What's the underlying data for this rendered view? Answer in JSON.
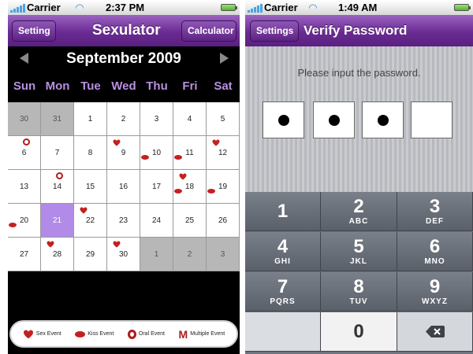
{
  "left": {
    "statusbar": {
      "carrier": "Carrier",
      "time": "2:37 PM"
    },
    "nav": {
      "left_button": "Setting",
      "title": "Sexulator",
      "right_button": "Calculator"
    },
    "calendar": {
      "month": "September 2009",
      "weekdays": [
        "Sun",
        "Mon",
        "Tue",
        "Wed",
        "Thu",
        "Fri",
        "Sat"
      ],
      "weeks": [
        [
          {
            "d": "30",
            "t": "other"
          },
          {
            "d": "31",
            "t": "other"
          },
          {
            "d": "1"
          },
          {
            "d": "2"
          },
          {
            "d": "3"
          },
          {
            "d": "4"
          },
          {
            "d": "5"
          }
        ],
        [
          {
            "d": "6",
            "m": [
              "oral"
            ]
          },
          {
            "d": "7"
          },
          {
            "d": "8"
          },
          {
            "d": "9",
            "m": [
              "heart"
            ]
          },
          {
            "d": "10",
            "m": [
              "kiss"
            ]
          },
          {
            "d": "11",
            "m": [
              "kiss"
            ]
          },
          {
            "d": "12",
            "m": [
              "heart"
            ]
          }
        ],
        [
          {
            "d": "13"
          },
          {
            "d": "14",
            "m": [
              "oral"
            ]
          },
          {
            "d": "15"
          },
          {
            "d": "16"
          },
          {
            "d": "17"
          },
          {
            "d": "18",
            "m": [
              "heart",
              "kiss"
            ]
          },
          {
            "d": "19",
            "m": [
              "kiss"
            ]
          }
        ],
        [
          {
            "d": "20",
            "m": [
              "kiss"
            ]
          },
          {
            "d": "21",
            "t": "selected"
          },
          {
            "d": "22",
            "m": [
              "heart"
            ]
          },
          {
            "d": "23"
          },
          {
            "d": "24"
          },
          {
            "d": "25"
          },
          {
            "d": "26"
          }
        ],
        [
          {
            "d": "27"
          },
          {
            "d": "28",
            "m": [
              "heart"
            ]
          },
          {
            "d": "29"
          },
          {
            "d": "30",
            "m": [
              "heart"
            ]
          },
          {
            "d": "1",
            "t": "other"
          },
          {
            "d": "2",
            "t": "other"
          },
          {
            "d": "3",
            "t": "other"
          }
        ]
      ]
    },
    "legend": {
      "sex": "Sex Event",
      "kiss": "Kiss Event",
      "oral": "Oral Event",
      "multiple_symbol": "M",
      "multiple": "Multiple Event"
    }
  },
  "right": {
    "statusbar": {
      "carrier": "Carrier",
      "time": "1:49 AM"
    },
    "nav": {
      "back_button": "Settings",
      "title": "Verify Password"
    },
    "prompt": "Please input the password.",
    "password_filled": [
      true,
      true,
      true,
      false
    ],
    "keys": [
      {
        "n": "1",
        "l": ""
      },
      {
        "n": "2",
        "l": "ABC"
      },
      {
        "n": "3",
        "l": "DEF"
      },
      {
        "n": "4",
        "l": "GHI"
      },
      {
        "n": "5",
        "l": "JKL"
      },
      {
        "n": "6",
        "l": "MNO"
      },
      {
        "n": "7",
        "l": "PQRS"
      },
      {
        "n": "8",
        "l": "TUV"
      },
      {
        "n": "9",
        "l": "WXYZ"
      },
      {
        "n": "",
        "l": "",
        "type": "blank"
      },
      {
        "n": "0",
        "l": "",
        "type": "zero"
      },
      {
        "n": "",
        "l": "",
        "type": "delete"
      }
    ]
  },
  "colors": {
    "nav_purple": "#6a2b92",
    "weekday": "#b890e0",
    "selected_day": "#b28be8",
    "event_red": "#c42020"
  },
  "icons": {
    "heart": "heart-icon",
    "kiss": "lips-icon",
    "oral": "o-ring-icon",
    "delete": "delete-backspace-icon",
    "wifi": "wifi-icon",
    "battery": "battery-icon",
    "signal": "signal-icon"
  }
}
